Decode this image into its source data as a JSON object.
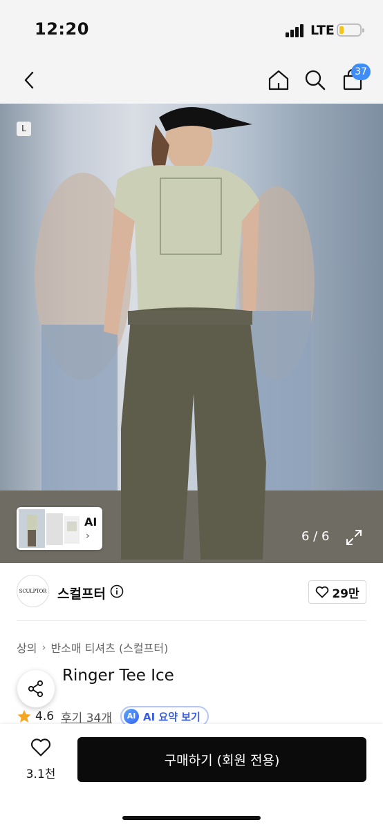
{
  "status": {
    "time": "12:20",
    "network": "LTE",
    "battery_level": 0.2
  },
  "nav": {
    "cart_count": "37",
    "icons": [
      "back-icon",
      "home-icon",
      "search-icon",
      "cart-icon"
    ]
  },
  "gallery": {
    "size_label": "L",
    "ai_label": "AI",
    "ai_chevron": "›",
    "page_indicator": "6 / 6"
  },
  "brand": {
    "logo_text": "SCULPTOR",
    "name": "스컬프터",
    "likes": "29만"
  },
  "breadcrumb": {
    "category": "상의",
    "separator": "›",
    "subcategory": "반소매 티셔츠 (스컬프터)"
  },
  "product": {
    "title_visible": "Ringer Tee Ice",
    "rating": "4.6",
    "reviews": "후기 34개",
    "ai_badge": "AI",
    "ai_summary": "AI 요약 보기"
  },
  "footer": {
    "wish_count": "3.1천",
    "buy_label": "구매하기 (회원 전용)"
  },
  "colors": {
    "accent": "#3f8ef7",
    "buy_button": "#0b0b0b",
    "star": "#f5a623",
    "ai_text": "#3a5fe0"
  }
}
